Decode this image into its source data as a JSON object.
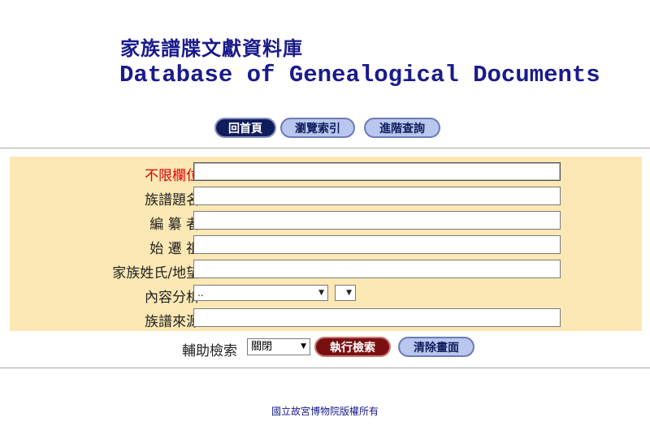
{
  "header": {
    "title_zh": "家族譜牒文獻資料庫",
    "title_en": "Database of Genealogical Documents"
  },
  "nav": {
    "home": "回首頁",
    "browse": "瀏覽索引",
    "advanced": "進階查詢"
  },
  "form": {
    "fields": [
      {
        "label": "不限欄位",
        "value": ""
      },
      {
        "label": "族譜題名",
        "value": ""
      },
      {
        "label": "編 纂 者",
        "value": ""
      },
      {
        "label": "始 遷 祖",
        "value": ""
      },
      {
        "label": "家族姓氏/地望",
        "value": ""
      }
    ],
    "content_analysis": {
      "label": "內容分析",
      "select1_value": "..",
      "select2_value": ""
    },
    "source": {
      "label": "族譜來源",
      "value": ""
    }
  },
  "aux": {
    "label": "輔助檢索",
    "select_value": "關閉",
    "execute": "執行檢索",
    "clear": "清除畫面"
  },
  "footer": {
    "copyright": "國立故宮博物院版權所有"
  },
  "icons": {
    "dropdown": "dropdown-arrow-icon"
  }
}
